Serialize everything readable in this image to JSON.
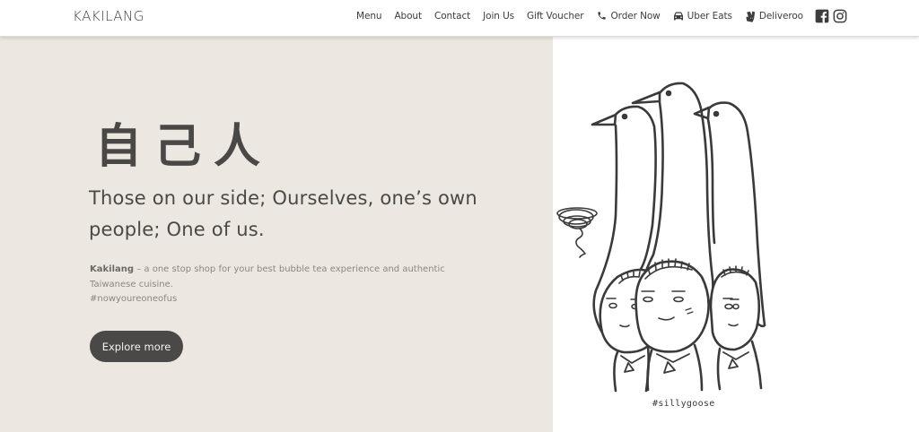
{
  "header": {
    "logo": "KAKILANG",
    "nav": [
      {
        "label": "Menu"
      },
      {
        "label": "About"
      },
      {
        "label": "Contact"
      },
      {
        "label": "Join Us"
      },
      {
        "label": "Gift Voucher"
      },
      {
        "label": "Order Now",
        "icon": "phone-icon"
      },
      {
        "label": "Uber Eats",
        "icon": "car-icon"
      },
      {
        "label": "Deliveroo",
        "icon": "deliveroo-icon"
      }
    ],
    "social": [
      "facebook-icon",
      "instagram-icon"
    ]
  },
  "hero": {
    "heading_cjk": "自己人",
    "tagline": "Those on our side; Ourselves, one’s own people; One of us.",
    "brand": "Kakilang",
    "description": " – a one stop shop for your best bubble tea experience and authentic Taiwanese cuisine.",
    "hashtag": "#nowyoureoneofus",
    "button_label": "Explore more",
    "illustration_caption": "#sillygoose",
    "illustration": "three-geese-illustration"
  },
  "colors": {
    "hero_left_bg": "#ece8e1",
    "text_dark": "#4a4847",
    "button_bg": "#4b4947",
    "text_muted": "#8b8682"
  }
}
